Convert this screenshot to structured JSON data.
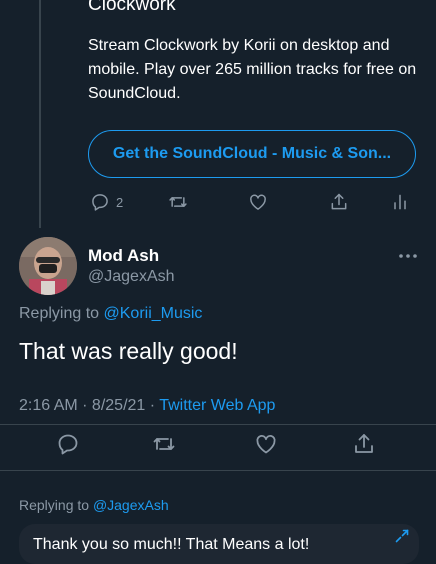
{
  "link_card": {
    "title": "Clockwork",
    "description": "Stream Clockwork by Korii on desktop and mobile. Play over 265 million tracks for free on SoundCloud.",
    "button_label": "Get the SoundCloud - Music & Son..."
  },
  "parent_actions": {
    "reply_count": "2"
  },
  "tweet": {
    "author_name": "Mod Ash",
    "author_handle": "@JagexAsh",
    "replying_prefix": "Replying to ",
    "replying_to": "@Korii_Music",
    "text": "That was really good!",
    "timestamp": "2:16 AM · 8/25/21 · ",
    "source": "Twitter Web App"
  },
  "reply_composer": {
    "replying_prefix": "Replying to ",
    "replying_to": "@JagexAsh",
    "draft_text": "Thank you so much!! That Means a lot!"
  },
  "icons": {
    "reply": "reply-icon",
    "retweet": "retweet-icon",
    "like": "heart-icon",
    "share": "share-icon",
    "analytics": "analytics-icon",
    "more": "more-icon",
    "expand": "expand-icon"
  },
  "colors": {
    "background": "#15202b",
    "accent": "#1d9bf0",
    "muted": "#8b98a5",
    "divider": "#38444d"
  }
}
